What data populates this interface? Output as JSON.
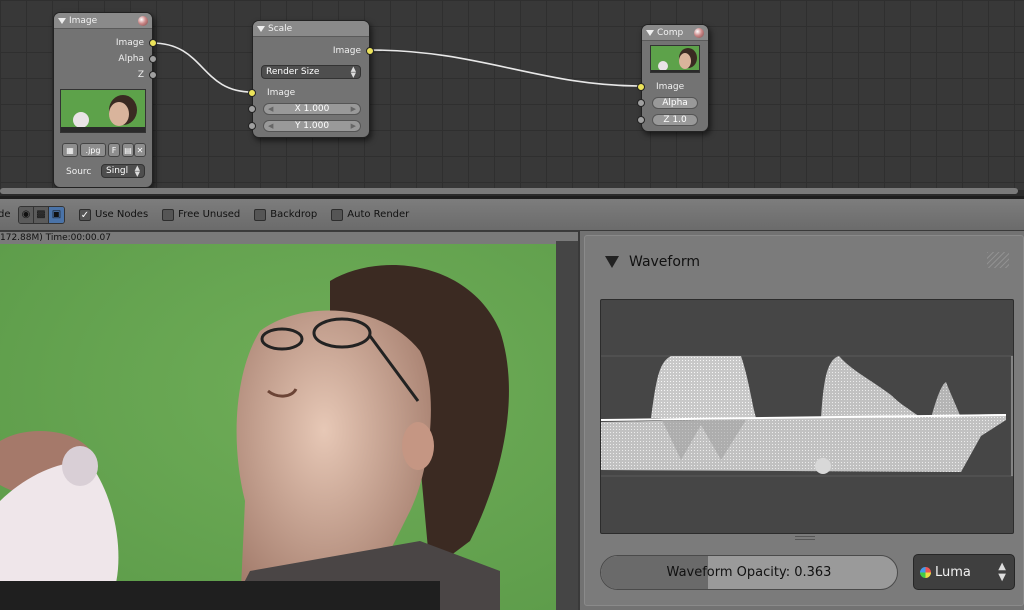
{
  "node_editor": {
    "image_node": {
      "title": "Image",
      "outputs": [
        "Image",
        "Alpha",
        "Z"
      ],
      "format_label": ".jpg",
      "frame_label": "F",
      "source_label": "Sourc",
      "source_value": "Singl"
    },
    "scale_node": {
      "title": "Scale",
      "output": "Image",
      "mode_value": "Render Size",
      "input": "Image",
      "x_field": "X 1.000",
      "y_field": "Y 1.000"
    },
    "comp_node": {
      "title": "Comp",
      "input": "Image",
      "alpha_field": "Alpha",
      "z_field": "Z 1.0"
    }
  },
  "header": {
    "edge_text": "de",
    "use_nodes": "Use Nodes",
    "free_unused": "Free Unused",
    "backdrop": "Backdrop",
    "auto_render": "Auto Render"
  },
  "viewer": {
    "info": "172.88M) Time:00:00.07"
  },
  "waveform_panel": {
    "title": "Waveform",
    "opacity_label": "Waveform Opacity: 0.363",
    "opacity_value": 0.363,
    "mode": "Luma"
  },
  "colors": {
    "socket_image": "#ece35a",
    "socket_value": "#a0a0a0",
    "greenscreen": "#64a24f",
    "active_view_icon": "#4a73a8"
  }
}
